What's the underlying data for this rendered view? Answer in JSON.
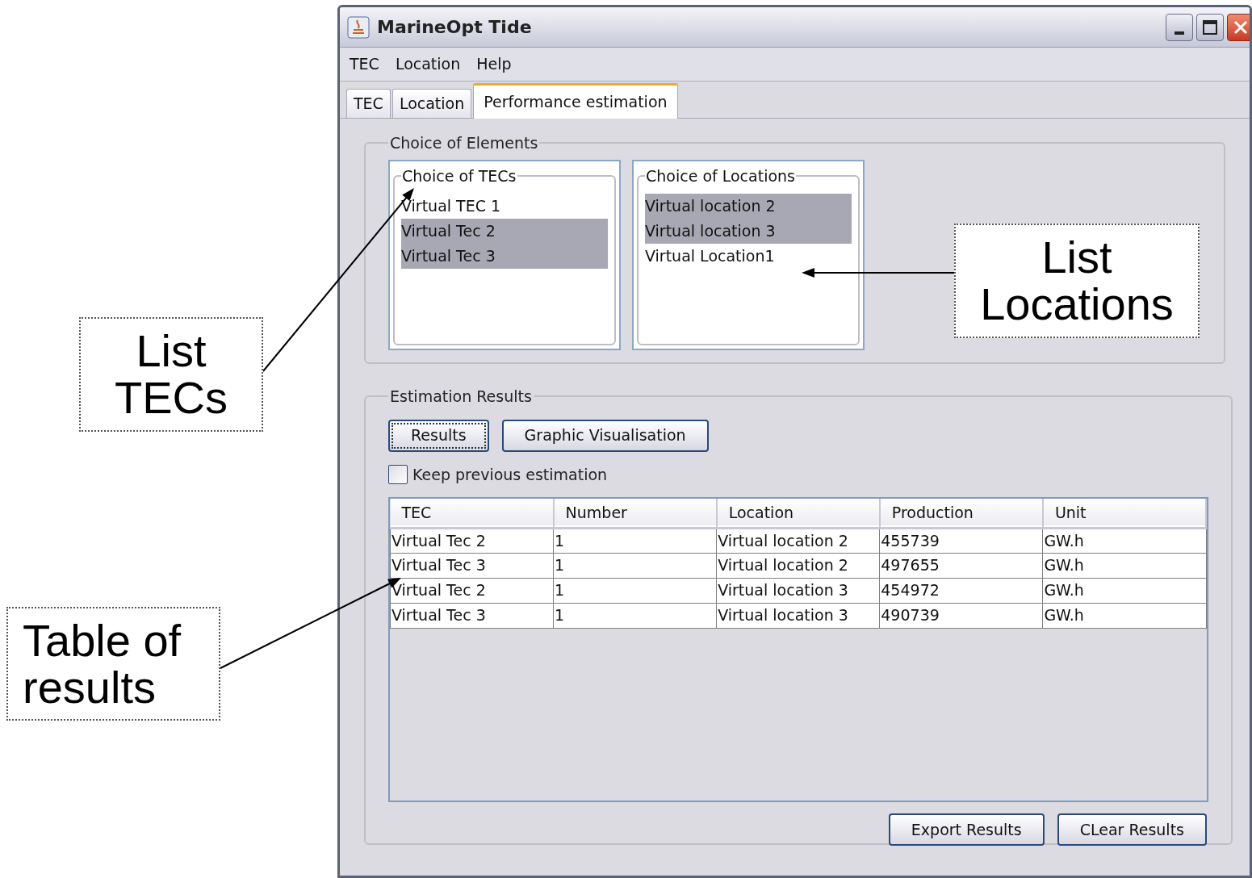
{
  "window": {
    "title": "MarineOpt Tide"
  },
  "menu": [
    "TEC",
    "Location",
    "Help"
  ],
  "tabs": [
    {
      "label": "TEC",
      "selected": false
    },
    {
      "label": "Location",
      "selected": false
    },
    {
      "label": "Performance estimation",
      "selected": true
    }
  ],
  "elements_group": {
    "title": "Choice of Elements",
    "tec_list": {
      "title": "Choice of TECs",
      "items": [
        {
          "label": "Virtual TEC 1",
          "selected": false
        },
        {
          "label": "Virtual Tec 2",
          "selected": true
        },
        {
          "label": "Virtual Tec 3",
          "selected": true
        }
      ]
    },
    "location_list": {
      "title": "Choice of Locations",
      "items": [
        {
          "label": "Virtual location 2",
          "selected": true
        },
        {
          "label": "Virtual location 3",
          "selected": true
        },
        {
          "label": "Virtual Location1",
          "selected": false
        }
      ]
    }
  },
  "results_group": {
    "title": "Estimation Results",
    "buttons": [
      {
        "label": "Results",
        "focused": true
      },
      {
        "label": "Graphic Visualisation",
        "focused": false
      }
    ],
    "keep_previous": {
      "label": "Keep previous estimation",
      "checked": false
    },
    "table": {
      "columns": [
        "TEC",
        "Number",
        "Location",
        "Production",
        "Unit"
      ],
      "rows": [
        [
          "Virtual Tec 2",
          "1",
          "Virtual location 2",
          "455739",
          "GW.h"
        ],
        [
          "Virtual Tec 3",
          "1",
          "Virtual location 2",
          "497655",
          "GW.h"
        ],
        [
          "Virtual Tec 2",
          "1",
          "Virtual location 3",
          "454972",
          "GW.h"
        ],
        [
          "Virtual Tec 3",
          "1",
          "Virtual location 3",
          "490739",
          "GW.h"
        ]
      ]
    },
    "actions": [
      "Export Results",
      "CLear Results"
    ]
  },
  "annotations": [
    {
      "lines": [
        "List",
        "TECs"
      ]
    },
    {
      "lines": [
        "Table of",
        "results"
      ]
    },
    {
      "lines": [
        "List",
        "Locations"
      ]
    }
  ]
}
